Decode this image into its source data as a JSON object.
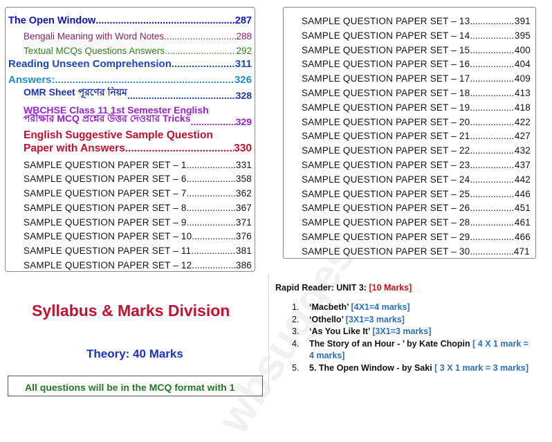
{
  "toc_left": [
    {
      "label": "The Open Window",
      "page": "287",
      "style": "toc-blue"
    },
    {
      "label": "Bengali Meaning with Word Notes",
      "page": "288",
      "style": "toc-plum"
    },
    {
      "label": "Textual MCQs Questions Answers",
      "page": "292",
      "style": "toc-green"
    },
    {
      "label": "Reading Unseen Comprehension",
      "page": "311",
      "style": "toc-blue2"
    },
    {
      "label": "Answers:",
      "page": "326",
      "style": "toc-cyan"
    },
    {
      "label": "OMR Sheet পূরণের নিয়ম",
      "page": "328",
      "style": "toc-navy"
    },
    {
      "label": "WBCHSE Class 11 1st Semester English",
      "page": "",
      "style": "toc-purple"
    },
    {
      "label": "পরীক্ষার MCQ প্রশ্নের উত্তর দেওয়ার Tricks",
      "page": "329",
      "style": "toc-purple"
    },
    {
      "label": "English Suggestive Sample Question",
      "page": "",
      "style": "toc-red"
    },
    {
      "label": "Paper with Answers",
      "page": "330",
      "style": "toc-red"
    },
    {
      "label": "SAMPLE QUESTION PAPER SET – 1",
      "page": "331",
      "style": "toc-black"
    },
    {
      "label": "SAMPLE QUESTION PAPER SET – 6",
      "page": "358",
      "style": "toc-black"
    },
    {
      "label": "SAMPLE QUESTION PAPER SET – 7",
      "page": "362",
      "style": "toc-black"
    },
    {
      "label": "SAMPLE QUESTION PAPER SET – 8",
      "page": "367",
      "style": "toc-black"
    },
    {
      "label": "SAMPLE QUESTION PAPER SET – 9",
      "page": "371",
      "style": "toc-black"
    },
    {
      "label": "SAMPLE QUESTION PAPER SET – 10",
      "page": "376",
      "style": "toc-black"
    },
    {
      "label": "SAMPLE QUESTION PAPER SET – 11",
      "page": "381",
      "style": "toc-black"
    },
    {
      "label": "SAMPLE QUESTION PAPER SET – 12",
      "page": "386",
      "style": "toc-black"
    }
  ],
  "toc_right": [
    {
      "label": "SAMPLE QUESTION PAPER SET – 13",
      "page": "391"
    },
    {
      "label": "SAMPLE QUESTION PAPER SET – 14",
      "page": "395"
    },
    {
      "label": "SAMPLE QUESTION PAPER SET – 15",
      "page": "400"
    },
    {
      "label": "SAMPLE QUESTION PAPER SET – 16",
      "page": "404"
    },
    {
      "label": "SAMPLE QUESTION PAPER SET – 17",
      "page": "409"
    },
    {
      "label": "SAMPLE QUESTION PAPER SET – 18",
      "page": "413"
    },
    {
      "label": "SAMPLE QUESTION PAPER SET – 19",
      "page": "418"
    },
    {
      "label": "SAMPLE QUESTION PAPER SET – 20",
      "page": "422"
    },
    {
      "label": "SAMPLE QUESTION PAPER SET – 21",
      "page": "427"
    },
    {
      "label": "SAMPLE QUESTION PAPER SET – 22",
      "page": "432"
    },
    {
      "label": "SAMPLE QUESTION PAPER SET – 23",
      "page": "437"
    },
    {
      "label": "SAMPLE QUESTION PAPER SET – 24",
      "page": "442"
    },
    {
      "label": "SAMPLE QUESTION PAPER SET – 25",
      "page": "446"
    },
    {
      "label": "SAMPLE QUESTION PAPER SET – 26",
      "page": "451"
    },
    {
      "label": "SAMPLE QUESTION PAPER SET – 28",
      "page": "461"
    },
    {
      "label": "SAMPLE QUESTION PAPER SET – 29",
      "page": "466"
    },
    {
      "label": "SAMPLE QUESTION PAPER SET – 30",
      "page": "471"
    }
  ],
  "syllabus": {
    "title": "Syllabus & Marks Division",
    "theory": "Theory: 40 Marks",
    "mcq_note": "All questions will be in the MCQ format with 1"
  },
  "rapid_reader": {
    "heading": "Rapid Reader: UNIT 3:",
    "marks": "[10 Marks]",
    "items": [
      {
        "num": "1.",
        "title": "‘Macbeth’",
        "marks": "[4X1=4 marks]"
      },
      {
        "num": "2.",
        "title": "‘Othello’",
        "marks": "[3X1=3 marks]"
      },
      {
        "num": "3.",
        "title": "‘As You Like It’",
        "marks": "[3X1=3 marks]"
      },
      {
        "num": "4.",
        "title": "The Story of an Hour - ’ by Kate Chopin",
        "marks": "[ 4 X 1 mark = 4 marks]"
      },
      {
        "num": "5.",
        "title": "5. The Open Window - by Saki",
        "marks": "[ 3  X 1 mark = 3 marks]"
      }
    ]
  },
  "colors": {
    "red": "#c8102e",
    "blue": "#1a2fd0",
    "green": "#1e7a1e",
    "marks_blue": "#2a6fc4"
  }
}
